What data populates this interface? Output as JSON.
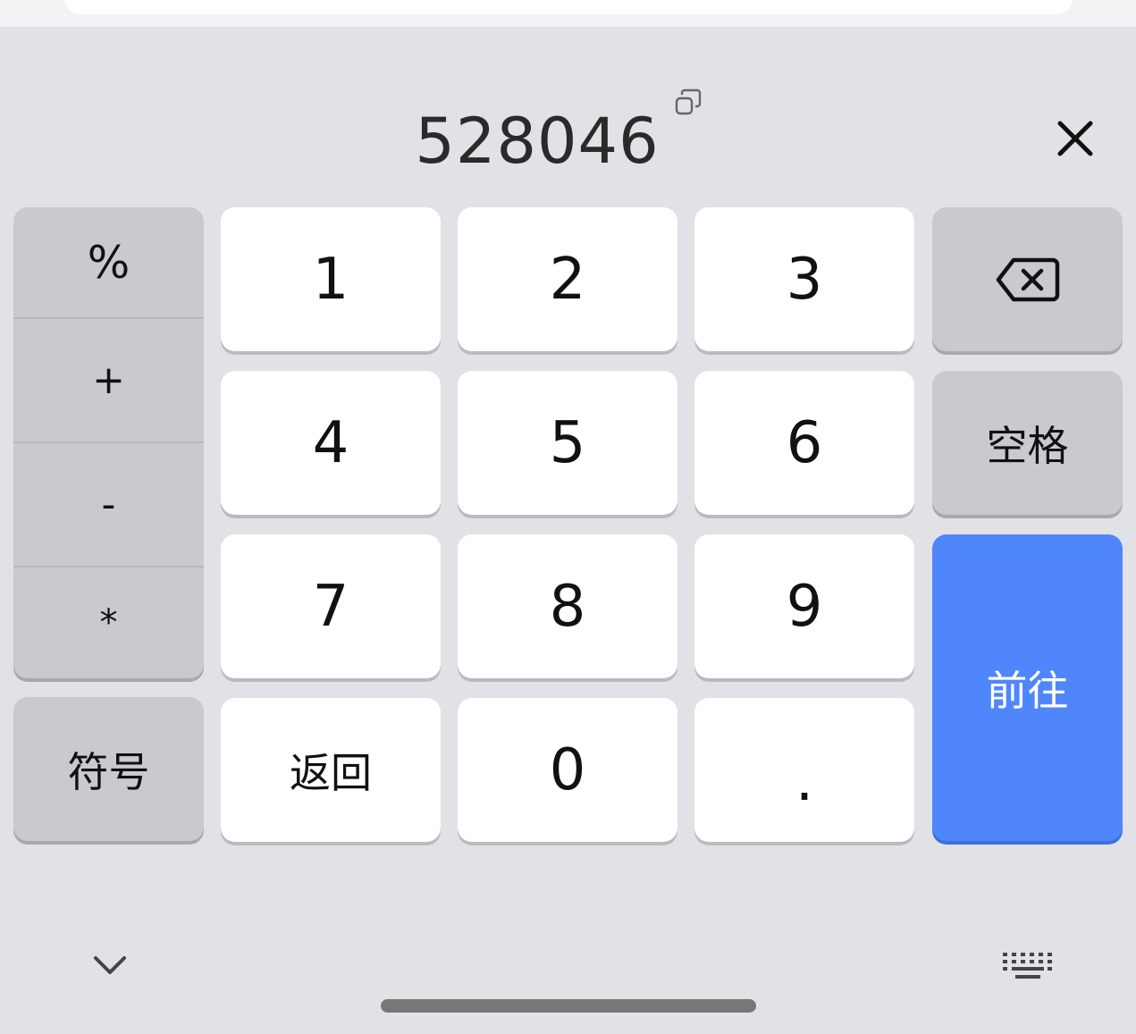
{
  "candidate": {
    "text": "528046"
  },
  "symbols": {
    "percent": "%",
    "plus": "+",
    "minus": "-",
    "asterisk": "*"
  },
  "keys": {
    "k1": "1",
    "k2": "2",
    "k3": "3",
    "k4": "4",
    "k5": "5",
    "k6": "6",
    "k7": "7",
    "k8": "8",
    "k9": "9",
    "k0": "0",
    "dot": ".",
    "symbols_toggle": "符号",
    "back": "返回",
    "space": "空格",
    "go": "前往"
  },
  "icons": {
    "copy": "copy-icon",
    "close": "close-icon",
    "backspace": "backspace-icon",
    "collapse": "chevron-down-icon",
    "keyboard": "keyboard-icon"
  },
  "colors": {
    "background": "#e1e2e6",
    "key_white": "#ffffff",
    "key_gray": "#c8cad0",
    "accent": "#4f86fb"
  }
}
